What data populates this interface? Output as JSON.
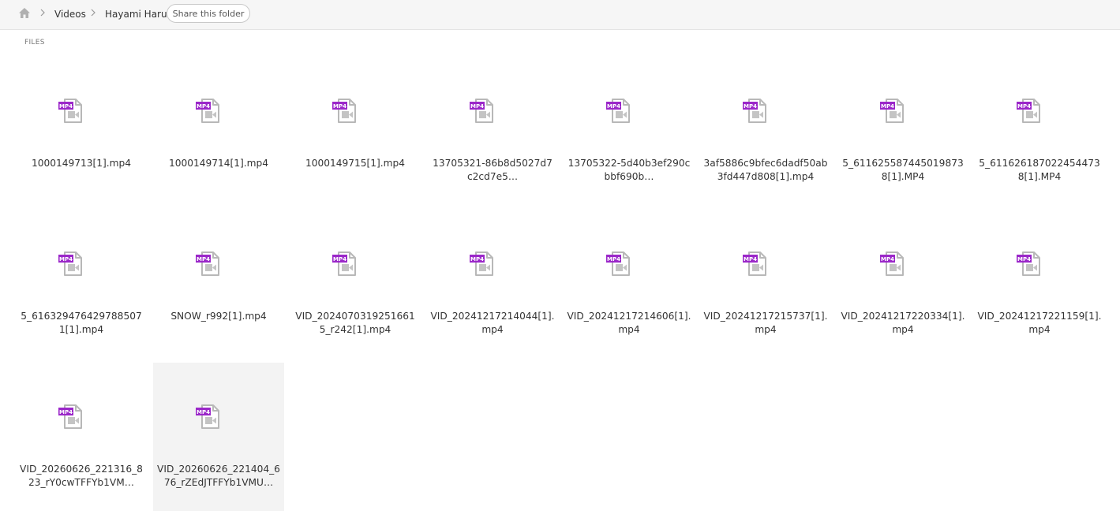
{
  "breadcrumb": {
    "home_icon": "home-icon",
    "items": [
      "Videos",
      "Hayami Haru"
    ],
    "share_label": "Share this folder"
  },
  "section_label": "FILES",
  "file_icon": {
    "name": "mp4-file-icon",
    "badge": "MP4",
    "badge_color": "#9b27c9",
    "outline_color": "#b8b8b8"
  },
  "files": [
    {
      "name": "1000149713[1].mp4"
    },
    {
      "name": "1000149714[1].mp4"
    },
    {
      "name": "1000149715[1].mp4"
    },
    {
      "name": "13705321-86b8d5027d7c2cd7e5…"
    },
    {
      "name": "13705322-5d40b3ef290cbbf690b…"
    },
    {
      "name": "3af5886c9bfec6dadf50ab3fd447d808[1].mp4"
    },
    {
      "name": "5_6116255874450198738[1].MP4"
    },
    {
      "name": "5_6116261870224544738[1].MP4"
    },
    {
      "name": "5_6163294764297885071[1].mp4"
    },
    {
      "name": "SNOW_r992[1].mp4"
    },
    {
      "name": "VID_20240703192516615_r242[1].mp4"
    },
    {
      "name": "VID_20241217214044[1].mp4"
    },
    {
      "name": "VID_20241217214606[1].mp4"
    },
    {
      "name": "VID_20241217215737[1].mp4"
    },
    {
      "name": "VID_20241217220334[1].mp4"
    },
    {
      "name": "VID_20241217221159[1].mp4"
    },
    {
      "name": "VID_20260626_221316_823_rY0cwTFFYb1VM…"
    },
    {
      "name": "VID_20260626_221404_676_rZEdJTFFYb1VMU…",
      "selected": true
    }
  ]
}
